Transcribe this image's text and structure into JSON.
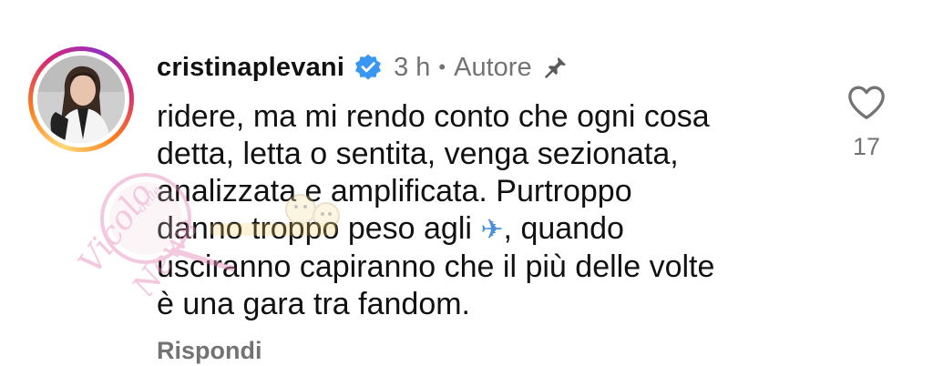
{
  "comment": {
    "username": "cristinaplevani",
    "time": "3 h",
    "separator": "•",
    "author_label": "Autore",
    "text_lines": [
      "ridere, ma mi rendo conto che ogni cosa",
      "detta, letta o sentita, venga sezionata,",
      "analizzata e amplificata. Purtroppo",
      "danno troppo peso agli",
      ", quando",
      "usciranno capiranno che il più delle volte",
      "è una gara tra fandom."
    ],
    "emoji": "✈",
    "reply_label": "Rispondi",
    "like_count": "17",
    "verified_color": "#3897f0"
  },
  "watermark": {
    "brand_line1": "Vicolo",
    "brand_small": "delle",
    "brand_line2": "News",
    "color": "#e48ab8"
  }
}
